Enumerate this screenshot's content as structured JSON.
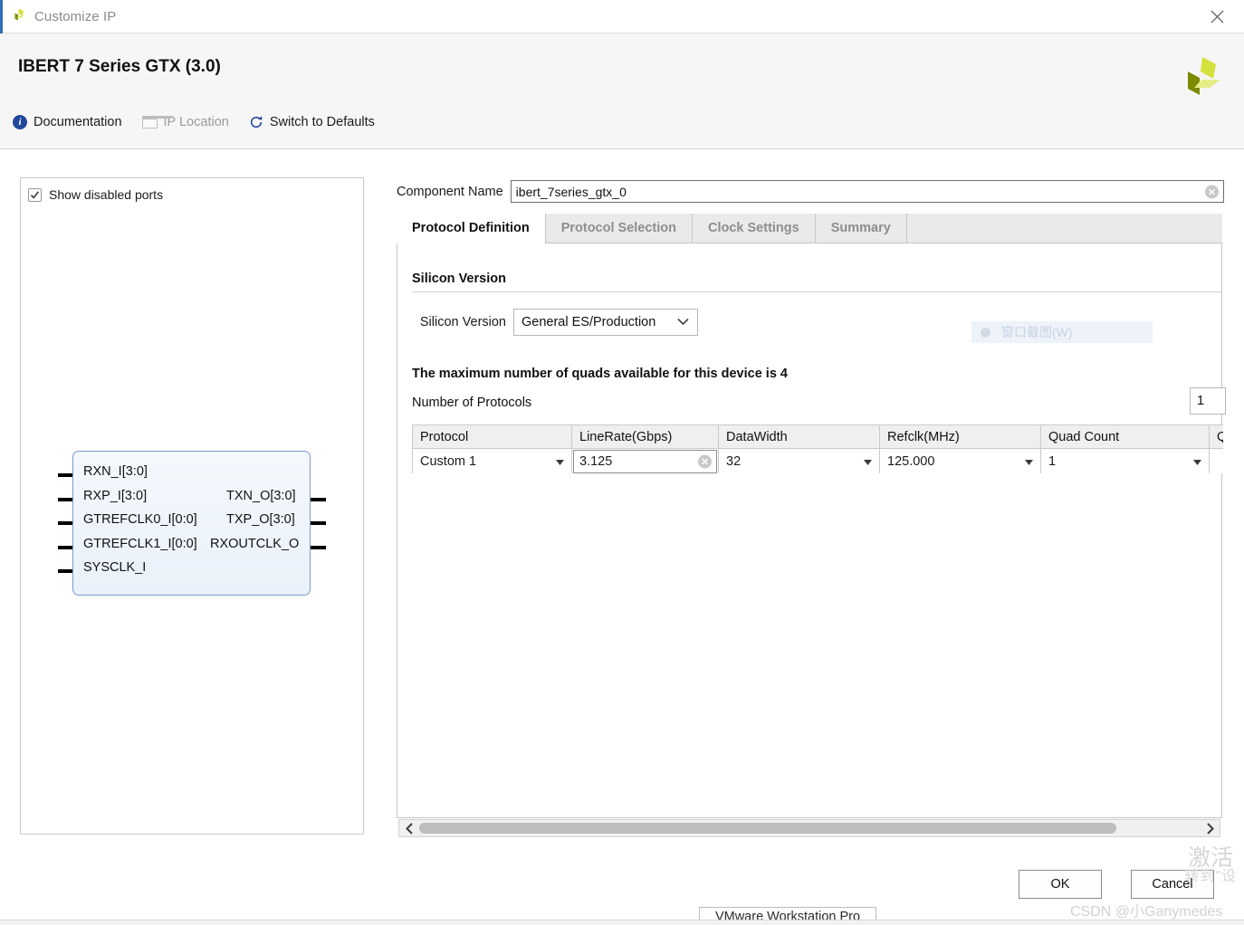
{
  "window": {
    "title": "Customize IP",
    "app_icon": "xilinx-logo-icon",
    "close_icon": "close-icon"
  },
  "header": {
    "title": "IBERT 7 Series GTX (3.0)",
    "logo_icon": "xilinx-logo-icon",
    "actions": [
      {
        "label": "Documentation",
        "icon": "info-icon",
        "enabled": true
      },
      {
        "label": "IP Location",
        "icon": "folder-icon",
        "enabled": false
      },
      {
        "label": "Switch to Defaults",
        "icon": "refresh-icon",
        "enabled": true
      }
    ]
  },
  "left_panel": {
    "show_disabled_ports": {
      "label": "Show disabled ports",
      "checked": true,
      "icon": "checkmark-icon"
    },
    "symbol": {
      "inputs": [
        "RXN_I[3:0]",
        "RXP_I[3:0]",
        "GTREFCLK0_I[0:0]",
        "GTREFCLK1_I[0:0]",
        "SYSCLK_I"
      ],
      "outputs": [
        "TXN_O[3:0]",
        "TXP_O[3:0]",
        "RXOUTCLK_O"
      ]
    }
  },
  "component_name": {
    "label": "Component Name",
    "value": "ibert_7series_gtx_0",
    "placeholder": "",
    "clear_icon": "clear-circle-icon"
  },
  "tabs": [
    {
      "label": "Protocol Definition",
      "active": true
    },
    {
      "label": "Protocol Selection",
      "active": false
    },
    {
      "label": "Clock Settings",
      "active": false
    },
    {
      "label": "Summary",
      "active": false
    }
  ],
  "protocol_definition": {
    "section_title": "Silicon Version",
    "silicon_version": {
      "label": "Silicon Version",
      "value": "General ES/Production",
      "chevron_icon": "chevron-down-icon"
    },
    "max_quads_note": "The maximum number of quads available for this device is 4",
    "number_of_protocols": {
      "label": "Number of Protocols",
      "value": "1"
    },
    "table": {
      "headers": [
        "Protocol",
        "LineRate(Gbps)",
        "DataWidth",
        "Refclk(MHz)",
        "Quad Count",
        "Qu"
      ],
      "rows": [
        {
          "protocol": "Custom 1",
          "line_rate": "3.125",
          "data_width": "32",
          "refclk": "125.000",
          "quad_count": "1",
          "quad_extra": ""
        }
      ]
    },
    "hscroll": {
      "left_icon": "chevron-left-icon",
      "right_icon": "chevron-right-icon"
    }
  },
  "ghost_overlay": {
    "label": "窗口截图(W)",
    "icon": "record-dot-icon"
  },
  "footer": {
    "ok_label": "OK",
    "cancel_label": "Cancel"
  },
  "watermarks": {
    "activate_line1": "激活",
    "activate_line2": "转到\"设",
    "csdn": "CSDN @小Ganymedes",
    "taskbar": "VMware Workstation Pro"
  },
  "colors": {
    "accent_blue": "#2f6fb5",
    "xilinx_green": "#cddc39",
    "xilinx_olive": "#7b8a00",
    "info_blue": "#21479b"
  }
}
